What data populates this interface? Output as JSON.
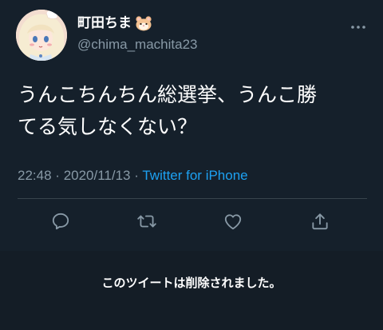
{
  "tweet": {
    "display_name": "町田ちま",
    "handle": "@chima_machita23",
    "text": "うんこちんちん総選挙、うんこ勝\nてる気しなくない？",
    "time": "22:48",
    "date": "2020/11/13",
    "separator": "·",
    "source": "Twitter for iPhone"
  },
  "actions": {
    "reply_icon": "reply-icon",
    "retweet_icon": "retweet-icon",
    "like_icon": "heart-icon",
    "share_icon": "share-icon"
  },
  "banner": {
    "deleted_message": "このツイートは削除されました。"
  },
  "colors": {
    "background": "#15202b",
    "secondary_text": "#8899a6",
    "link": "#1da1f2",
    "divider": "#38444d"
  }
}
